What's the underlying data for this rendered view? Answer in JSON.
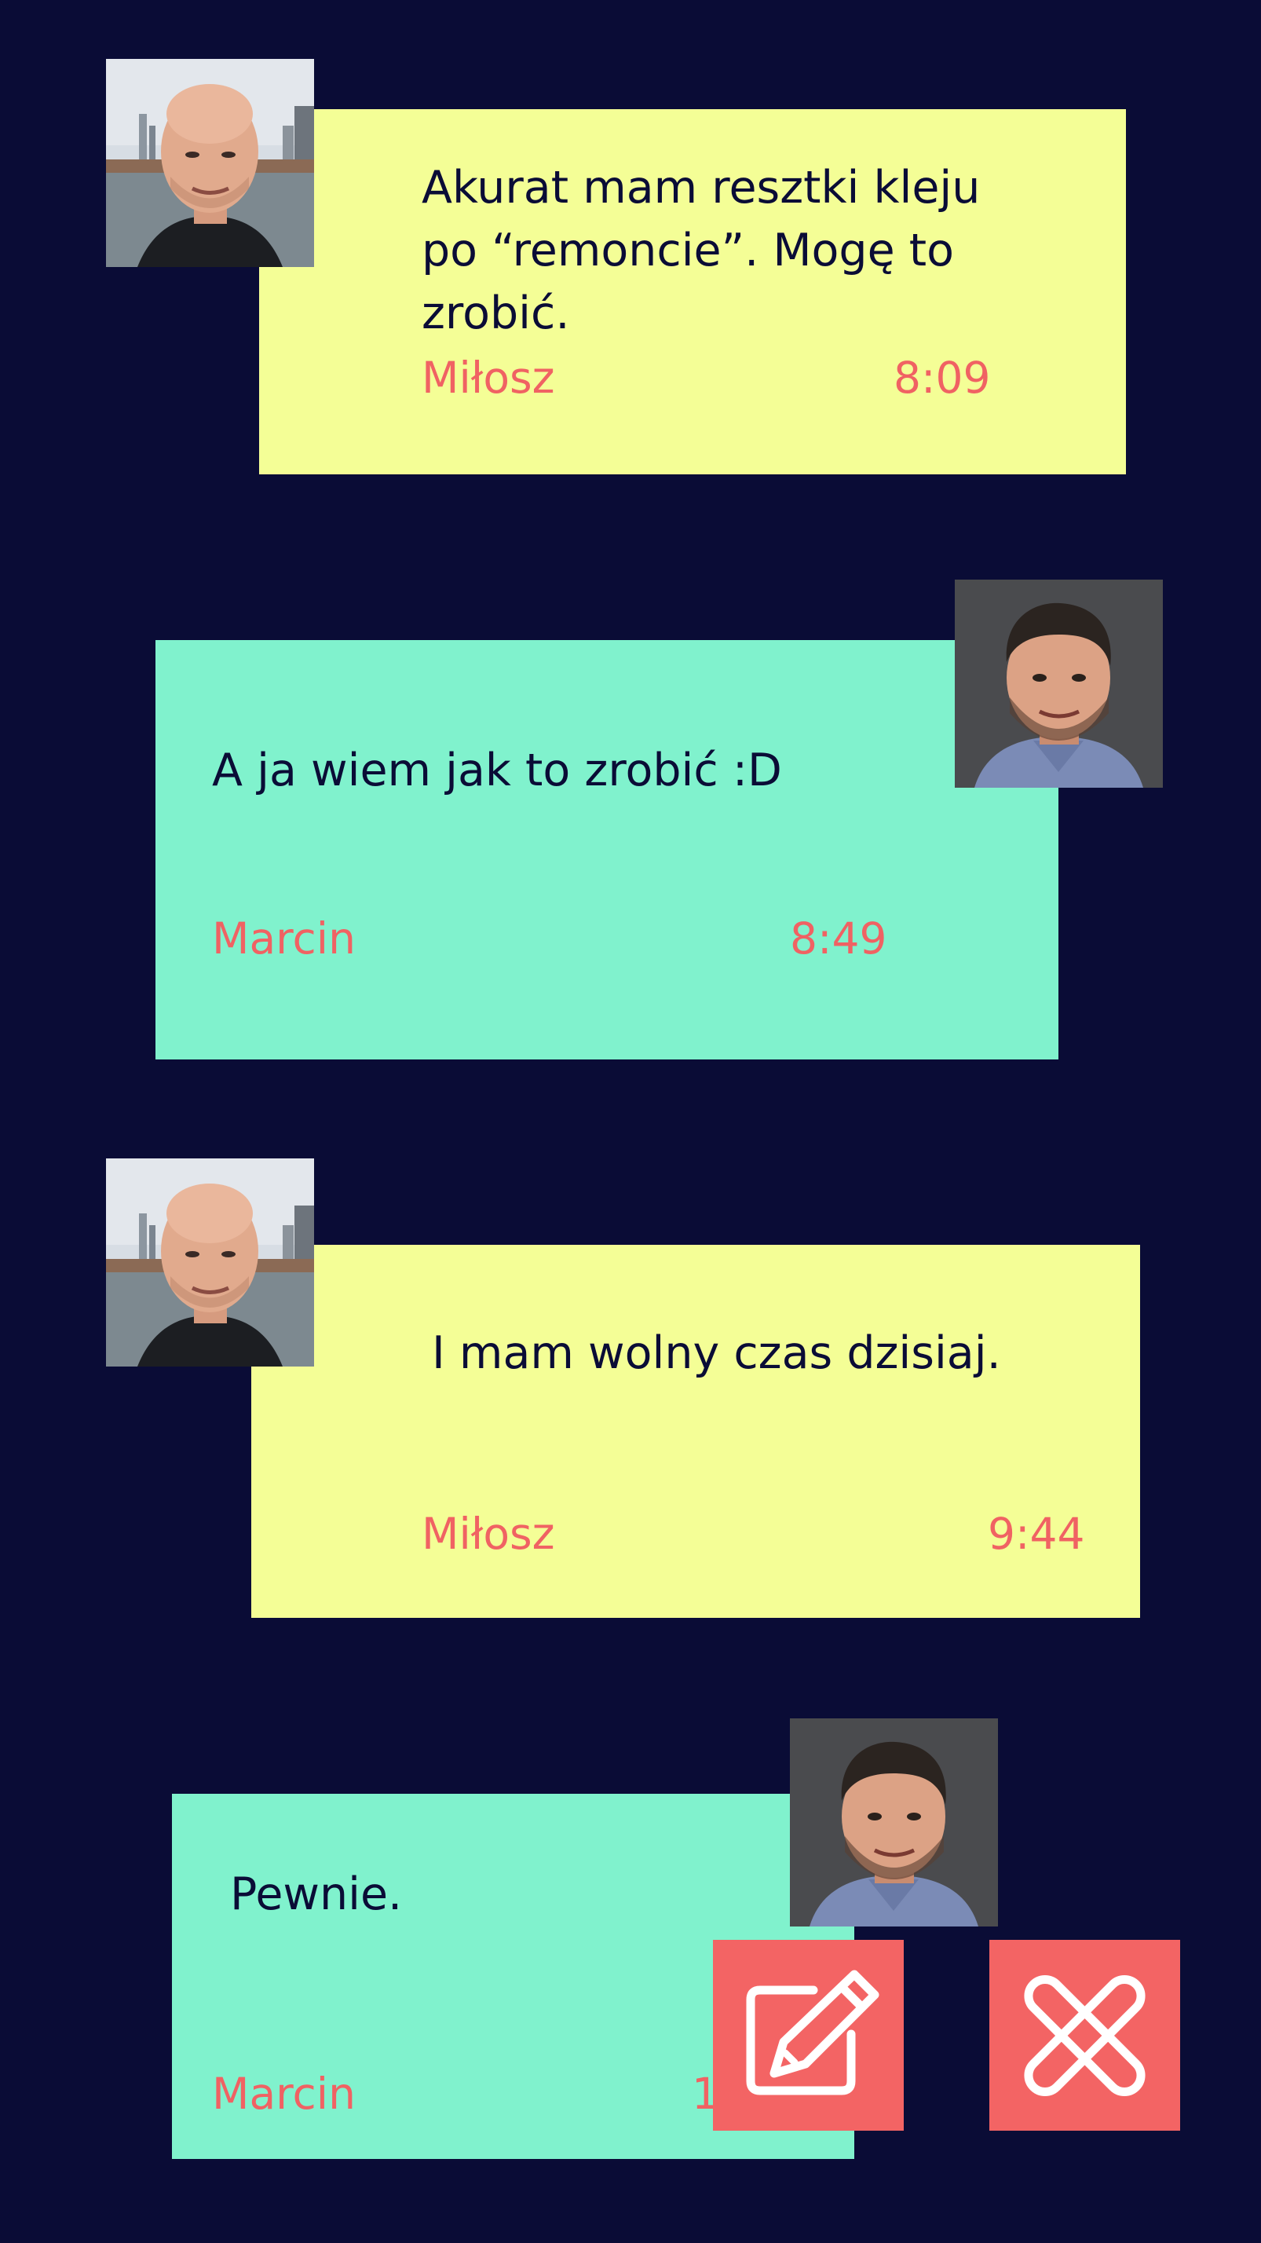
{
  "messages": [
    {
      "text": "Akurat mam resztki kleju po “remoncie”. Mogę to zrobić.",
      "sender": "Miłosz",
      "time": "8:09"
    },
    {
      "text": "A ja wiem jak to zrobić  :D",
      "sender": "Marcin",
      "time": "8:49"
    },
    {
      "text": "I mam wolny czas dzisiaj.",
      "sender": "Miłosz",
      "time": "9:44"
    },
    {
      "text": "Pewnie.",
      "sender": "Marcin",
      "time": "1"
    }
  ],
  "actions": {
    "edit_icon": "pencil-square-icon",
    "delete_icon": "close-x-icon"
  },
  "colors": {
    "background": "#0a0c36",
    "bubble_milosz": "#f4fe96",
    "bubble_marcin": "#80f2cd",
    "accent": "#f06263",
    "action": "#f36464"
  }
}
